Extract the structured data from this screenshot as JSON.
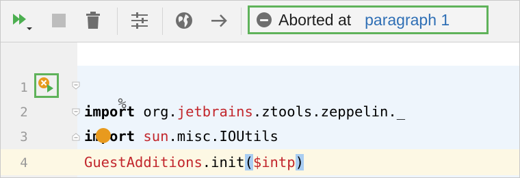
{
  "toolbar": {
    "status_text": "Aborted at",
    "status_link": "paragraph 1",
    "icons": [
      "run-all-icon",
      "stop-icon",
      "trash-icon",
      "settings-sliders-icon",
      "globe-icon",
      "arrow-right-icon",
      "abort-status-icon"
    ]
  },
  "editor": {
    "lines": [
      {
        "number": "1",
        "text": "%"
      },
      {
        "number": "2",
        "kw": "import",
        "a": " org.",
        "b": "jetbrains",
        "c": ".ztools.zeppelin._"
      },
      {
        "number": "3",
        "kw": "import",
        "a": " ",
        "b": "sun",
        "c": ".misc.IOUtils"
      },
      {
        "number": "4",
        "a": "GuestAdditions",
        "b": ".init(",
        "c": "$intp",
        "d": ")"
      }
    ]
  },
  "colors": {
    "accent_green": "#5fb25a",
    "run_green": "#4caf50",
    "link_blue": "#2f6fb5",
    "error_orange": "#e89a1e",
    "code_red": "#c2262c"
  }
}
